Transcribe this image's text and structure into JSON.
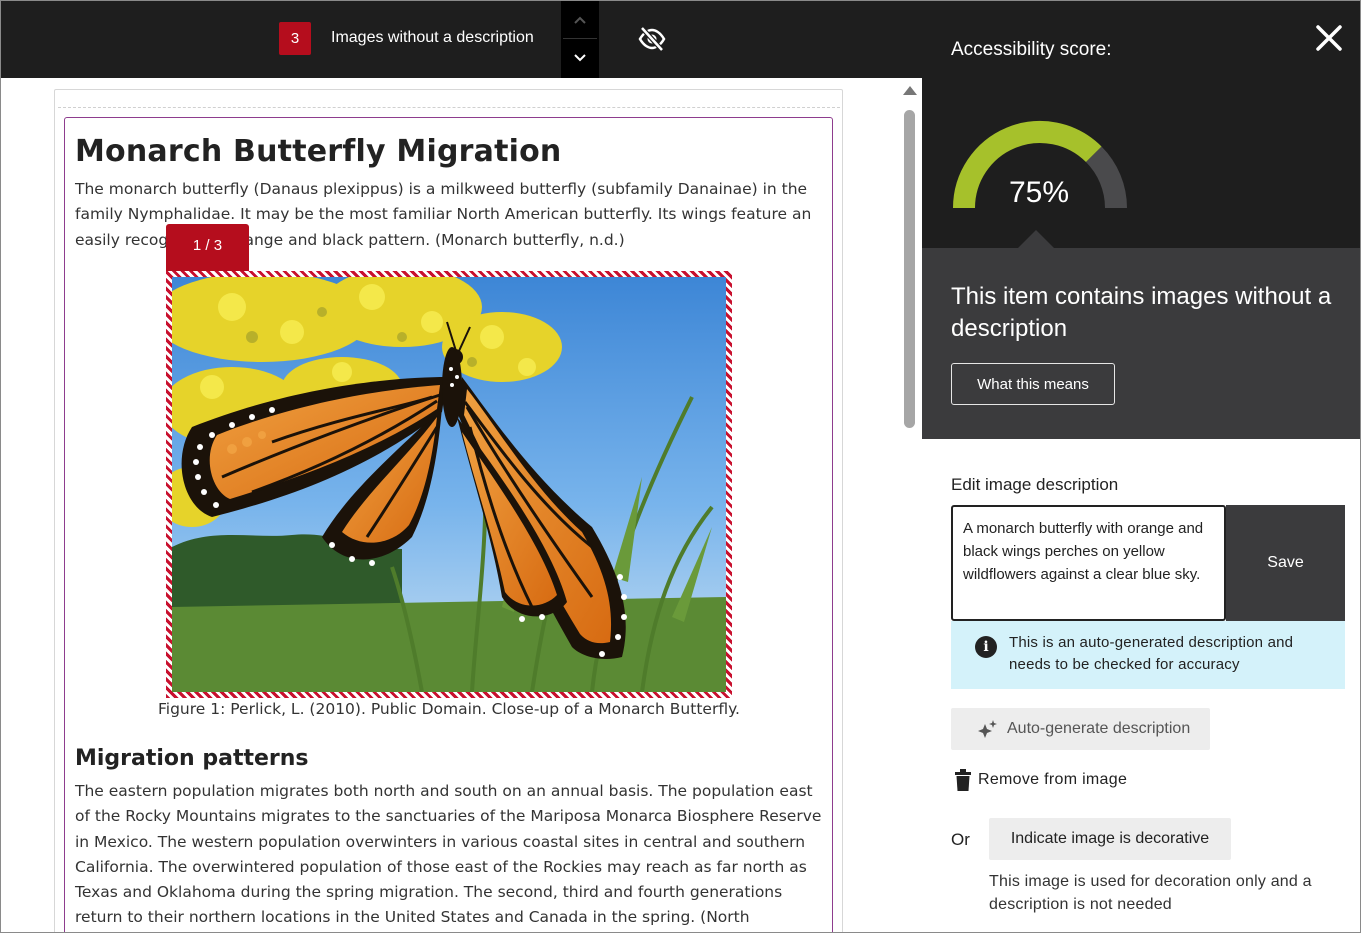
{
  "topbar": {
    "issue_count": "3",
    "issue_label": "Images without a description",
    "icons": {
      "prev": "chevron-up-icon",
      "next": "chevron-down-icon",
      "hide": "eye-slash-icon"
    }
  },
  "document": {
    "title": "Monarch Butterfly Migration",
    "intro": "The monarch butterfly (Danaus plexippus) is a milkweed butterfly (subfamily Danainae) in the family Nymphalidae. It may be the most familiar North American butterfly. Its wings feature an easily recognizable orange and black pattern. (Monarch butterfly, n.d.)",
    "image_counter": "1 / 3",
    "figure_caption": "Figure 1: Perlick, L. (2010). Public Domain. Close-up of a Monarch Butterfly.",
    "section_heading": "Migration patterns",
    "section_text": "The eastern population migrates both north and south on an annual basis. The population east of the Rocky Mountains migrates to the sanctuaries of the Mariposa Monarca Biosphere Reserve in Mexico. The western population overwinters in various coastal sites in central and southern California. The overwintered population of those east of the Rockies may reach as far north as Texas and Oklahoma during the spring migration. The second, third and fourth generations return to their northern locations in the United States and Canada in the spring. (North American Monarch Conservation Plan)."
  },
  "panel": {
    "score_label": "Accessibility score:",
    "score": 75,
    "score_text": "75%",
    "issue_title": "This item contains images without a description",
    "what_button": "What this means",
    "edit_label": "Edit image description",
    "description_value": "A monarch butterfly with orange and black wings perches on yellow wildflowers against a clear blue sky.",
    "save_button": "Save",
    "info_text": "This is an auto-generated description and needs to be checked for accuracy",
    "autogen_button": "Auto-generate description",
    "remove_button": "Remove from image",
    "or_label": "Or",
    "decorative_button": "Indicate image is decorative",
    "decorative_note": "This image is used for decoration only and a description is not needed",
    "colors": {
      "gauge_fill": "#a6c12b",
      "gauge_track": "#4a4a4c",
      "alert": "#b50d1d",
      "info_bg": "#d4f2fa"
    },
    "icons": {
      "close": "close-icon",
      "info": "info-icon",
      "autogen": "sparkle-icon",
      "remove": "trash-icon"
    }
  }
}
